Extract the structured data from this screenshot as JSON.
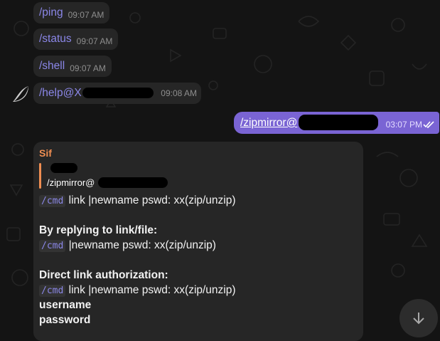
{
  "colors": {
    "background": "#141414",
    "bubble": "#262626",
    "outgoing_bubble": "#7a64d4",
    "command": "#8b87e8",
    "sender": "#ef8e52"
  },
  "messages": [
    {
      "command": "/ping",
      "time": "09:07 AM"
    },
    {
      "command": "/status",
      "time": "09:07 AM"
    },
    {
      "command": "/shell",
      "time": "09:07 AM"
    },
    {
      "command": "/help@X",
      "time": "09:08 AM"
    }
  ],
  "outgoing": {
    "text": "/zipmirror@",
    "time": "03:07 PM",
    "status_icon": "double-check-icon"
  },
  "reply": {
    "sender": "Sif",
    "quote": "/zipmirror@",
    "l1_code": "/cmd",
    "l1_text": "link |newname pswd: xx(zip/unzip)",
    "l2": "By replying to link/file:",
    "l3_code": "/cmd",
    "l3_text": "|newname pswd: xx(zip/unzip)",
    "l4": "Direct link authorization:",
    "l5_code": "/cmd",
    "l5_text": "link |newname pswd: xx(zip/unzip)",
    "l6": "username",
    "l7": "password"
  },
  "scroll_button_icon": "arrow-down-icon"
}
